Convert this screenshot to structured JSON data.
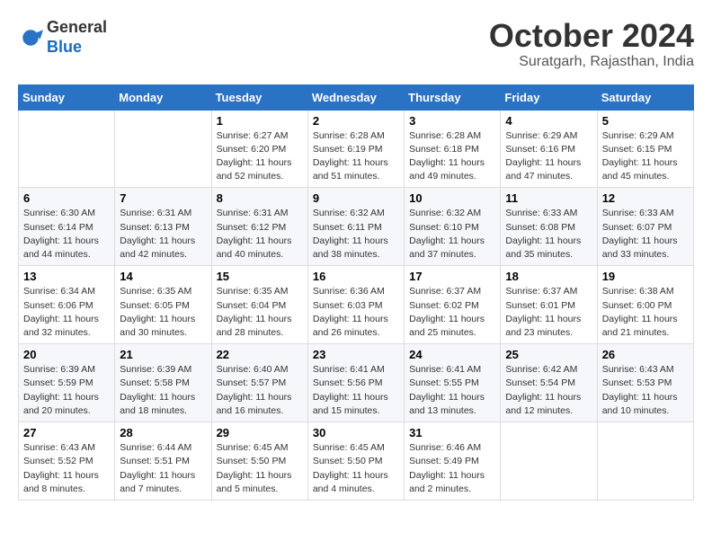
{
  "logo": {
    "general": "General",
    "blue": "Blue"
  },
  "header": {
    "month": "October 2024",
    "location": "Suratgarh, Rajasthan, India"
  },
  "days_of_week": [
    "Sunday",
    "Monday",
    "Tuesday",
    "Wednesday",
    "Thursday",
    "Friday",
    "Saturday"
  ],
  "weeks": [
    [
      {
        "day": "",
        "info": ""
      },
      {
        "day": "",
        "info": ""
      },
      {
        "day": "1",
        "info": "Sunrise: 6:27 AM\nSunset: 6:20 PM\nDaylight: 11 hours and 52 minutes."
      },
      {
        "day": "2",
        "info": "Sunrise: 6:28 AM\nSunset: 6:19 PM\nDaylight: 11 hours and 51 minutes."
      },
      {
        "day": "3",
        "info": "Sunrise: 6:28 AM\nSunset: 6:18 PM\nDaylight: 11 hours and 49 minutes."
      },
      {
        "day": "4",
        "info": "Sunrise: 6:29 AM\nSunset: 6:16 PM\nDaylight: 11 hours and 47 minutes."
      },
      {
        "day": "5",
        "info": "Sunrise: 6:29 AM\nSunset: 6:15 PM\nDaylight: 11 hours and 45 minutes."
      }
    ],
    [
      {
        "day": "6",
        "info": "Sunrise: 6:30 AM\nSunset: 6:14 PM\nDaylight: 11 hours and 44 minutes."
      },
      {
        "day": "7",
        "info": "Sunrise: 6:31 AM\nSunset: 6:13 PM\nDaylight: 11 hours and 42 minutes."
      },
      {
        "day": "8",
        "info": "Sunrise: 6:31 AM\nSunset: 6:12 PM\nDaylight: 11 hours and 40 minutes."
      },
      {
        "day": "9",
        "info": "Sunrise: 6:32 AM\nSunset: 6:11 PM\nDaylight: 11 hours and 38 minutes."
      },
      {
        "day": "10",
        "info": "Sunrise: 6:32 AM\nSunset: 6:10 PM\nDaylight: 11 hours and 37 minutes."
      },
      {
        "day": "11",
        "info": "Sunrise: 6:33 AM\nSunset: 6:08 PM\nDaylight: 11 hours and 35 minutes."
      },
      {
        "day": "12",
        "info": "Sunrise: 6:33 AM\nSunset: 6:07 PM\nDaylight: 11 hours and 33 minutes."
      }
    ],
    [
      {
        "day": "13",
        "info": "Sunrise: 6:34 AM\nSunset: 6:06 PM\nDaylight: 11 hours and 32 minutes."
      },
      {
        "day": "14",
        "info": "Sunrise: 6:35 AM\nSunset: 6:05 PM\nDaylight: 11 hours and 30 minutes."
      },
      {
        "day": "15",
        "info": "Sunrise: 6:35 AM\nSunset: 6:04 PM\nDaylight: 11 hours and 28 minutes."
      },
      {
        "day": "16",
        "info": "Sunrise: 6:36 AM\nSunset: 6:03 PM\nDaylight: 11 hours and 26 minutes."
      },
      {
        "day": "17",
        "info": "Sunrise: 6:37 AM\nSunset: 6:02 PM\nDaylight: 11 hours and 25 minutes."
      },
      {
        "day": "18",
        "info": "Sunrise: 6:37 AM\nSunset: 6:01 PM\nDaylight: 11 hours and 23 minutes."
      },
      {
        "day": "19",
        "info": "Sunrise: 6:38 AM\nSunset: 6:00 PM\nDaylight: 11 hours and 21 minutes."
      }
    ],
    [
      {
        "day": "20",
        "info": "Sunrise: 6:39 AM\nSunset: 5:59 PM\nDaylight: 11 hours and 20 minutes."
      },
      {
        "day": "21",
        "info": "Sunrise: 6:39 AM\nSunset: 5:58 PM\nDaylight: 11 hours and 18 minutes."
      },
      {
        "day": "22",
        "info": "Sunrise: 6:40 AM\nSunset: 5:57 PM\nDaylight: 11 hours and 16 minutes."
      },
      {
        "day": "23",
        "info": "Sunrise: 6:41 AM\nSunset: 5:56 PM\nDaylight: 11 hours and 15 minutes."
      },
      {
        "day": "24",
        "info": "Sunrise: 6:41 AM\nSunset: 5:55 PM\nDaylight: 11 hours and 13 minutes."
      },
      {
        "day": "25",
        "info": "Sunrise: 6:42 AM\nSunset: 5:54 PM\nDaylight: 11 hours and 12 minutes."
      },
      {
        "day": "26",
        "info": "Sunrise: 6:43 AM\nSunset: 5:53 PM\nDaylight: 11 hours and 10 minutes."
      }
    ],
    [
      {
        "day": "27",
        "info": "Sunrise: 6:43 AM\nSunset: 5:52 PM\nDaylight: 11 hours and 8 minutes."
      },
      {
        "day": "28",
        "info": "Sunrise: 6:44 AM\nSunset: 5:51 PM\nDaylight: 11 hours and 7 minutes."
      },
      {
        "day": "29",
        "info": "Sunrise: 6:45 AM\nSunset: 5:50 PM\nDaylight: 11 hours and 5 minutes."
      },
      {
        "day": "30",
        "info": "Sunrise: 6:45 AM\nSunset: 5:50 PM\nDaylight: 11 hours and 4 minutes."
      },
      {
        "day": "31",
        "info": "Sunrise: 6:46 AM\nSunset: 5:49 PM\nDaylight: 11 hours and 2 minutes."
      },
      {
        "day": "",
        "info": ""
      },
      {
        "day": "",
        "info": ""
      }
    ]
  ]
}
